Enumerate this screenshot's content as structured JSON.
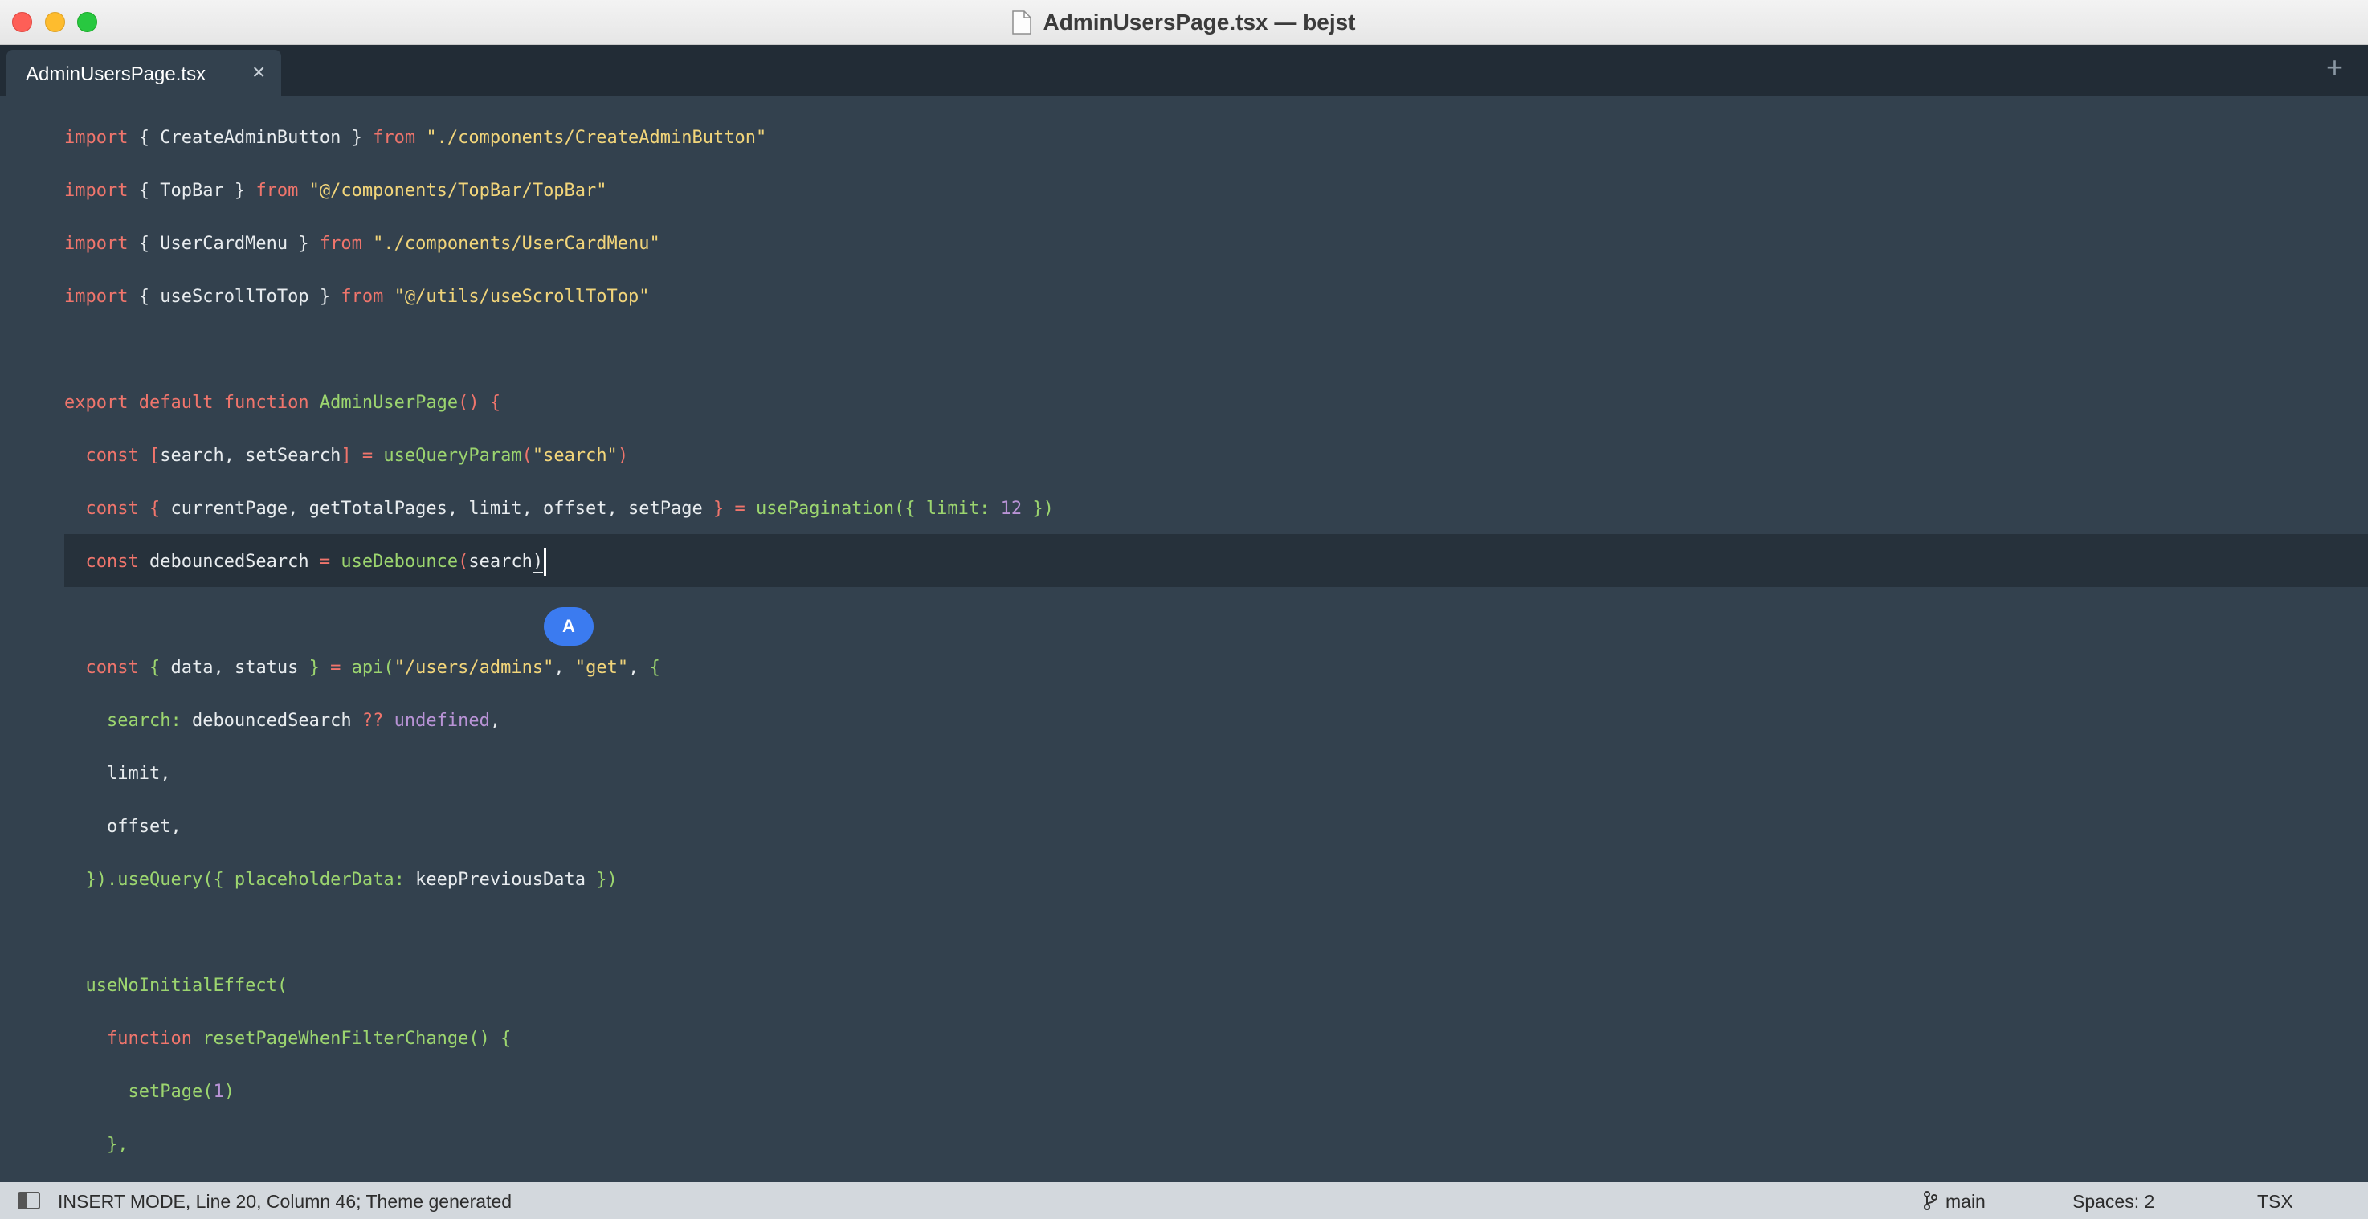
{
  "window": {
    "title": "AdminUsersPage.tsx — bejst"
  },
  "tabs": [
    {
      "label": "AdminUsersPage.tsx",
      "close": "×"
    }
  ],
  "new_tab": "+",
  "editor": {
    "lines": [
      "import { CreateAdminButton } from \"./components/CreateAdminButton\"",
      "import { TopBar } from \"@/components/TopBar/TopBar\"",
      "import { UserCardMenu } from \"./components/UserCardMenu\"",
      "import { useScrollToTop } from \"@/utils/useScrollToTop\"",
      "",
      "export default function AdminUserPage() {",
      "  const [search, setSearch] = useQueryParam(\"search\")",
      "  const { currentPage, getTotalPages, limit, offset, setPage } = usePagination({ limit: 12 })",
      "  const debouncedSearch = useDebounce(search)",
      "",
      "  const { data, status } = api(\"/users/admins\", \"get\", {",
      "    search: debouncedSearch ?? undefined,",
      "    limit,",
      "    offset,",
      "  }).useQuery({ placeholderData: keepPreviousData })",
      "",
      "  useNoInitialEffect(",
      "    function resetPageWhenFilterChange() {",
      "      setPage(1)",
      "    },"
    ],
    "current_line_index": 8,
    "hint_badge": "A"
  },
  "statusbar": {
    "status": "INSERT MODE, Line 20, Column 46; Theme generated",
    "branch": "main",
    "spaces": "Spaces: 2",
    "language": "TSX"
  },
  "colors": {
    "background": "#33414e",
    "keyword": "#f0756c",
    "string": "#f2d57a",
    "function": "#9cd56f",
    "number": "#b993d6",
    "text": "#e8ecef",
    "badge": "#3b7bf0"
  }
}
